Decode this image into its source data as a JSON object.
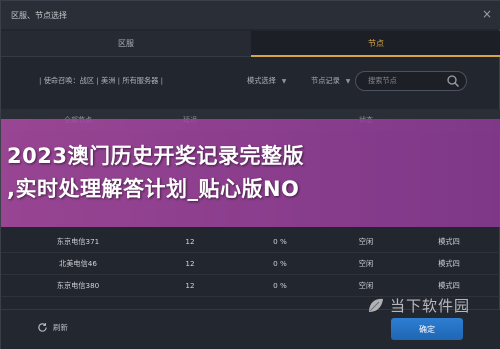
{
  "window": {
    "title": "区服、节点选择",
    "close_glyph": "×"
  },
  "tabs": [
    {
      "label": "区服",
      "active": false
    },
    {
      "label": "节点",
      "active": true
    }
  ],
  "filter": {
    "breadcrumb": "| 使命召唤：战区 | 美洲 | 所有服务器 |",
    "mode_label": "模式选择",
    "record_label": "节点记录",
    "search_placeholder": "搜索节点"
  },
  "table": {
    "headers": [
      "全部节点",
      "延迟",
      "",
      "状态",
      ""
    ],
    "rows": [
      {
        "name": "东京电信371",
        "latency": "12",
        "loss": "0 %",
        "status": "空闲",
        "mode": "模式四"
      },
      {
        "name": "北美电信46",
        "latency": "12",
        "loss": "0 %",
        "status": "空闲",
        "mode": "模式四"
      },
      {
        "name": "东京电信380",
        "latency": "12",
        "loss": "0 %",
        "status": "空闲",
        "mode": "模式四"
      }
    ]
  },
  "footer": {
    "refresh_label": "刷新",
    "confirm_label": "确定"
  },
  "watermark": {
    "text": "当下软件园"
  },
  "overlay": {
    "line1": "2023澳门历史开奖记录完整版",
    "line2": ",实时处理解答计划_贴心版NO"
  },
  "colors": {
    "accent": "#d7a548",
    "button": "#2372c4",
    "overlay": "#a84aa3"
  }
}
